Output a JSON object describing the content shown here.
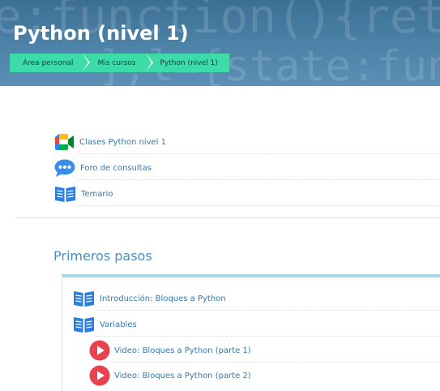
{
  "header": {
    "title": "Python (nivel 1)",
    "code_line_1": "e:function(){return",
    "code_line_2": "];l={state:fun"
  },
  "breadcrumb": [
    {
      "label": "Área personal"
    },
    {
      "label": "Mis cursos"
    },
    {
      "label": "Python (nivel 1)"
    }
  ],
  "general_activities": [
    {
      "label": "Clases Python nivel 1",
      "icon": "google-meet-icon"
    },
    {
      "label": "Foro de consultas",
      "icon": "forum-chat-icon"
    },
    {
      "label": "Temario",
      "icon": "book-icon"
    }
  ],
  "section": {
    "title": "Primeros pasos",
    "items": [
      {
        "label": "Introducción: Bloques a Python",
        "icon": "book-icon"
      },
      {
        "label": "Variables",
        "icon": "book-icon"
      },
      {
        "label": "Video: Bloques a Python (parte 1)",
        "icon": "video-play-icon"
      },
      {
        "label": "Video: Bloques a Python (parte 2)",
        "icon": "video-play-icon"
      }
    ]
  },
  "colors": {
    "header_blue": "#4a7fa6",
    "breadcrumb_green": "#3ddba8",
    "link_blue": "#2f7ab7",
    "section_accent": "#a9d6ea",
    "video_red": "#e8424f"
  }
}
